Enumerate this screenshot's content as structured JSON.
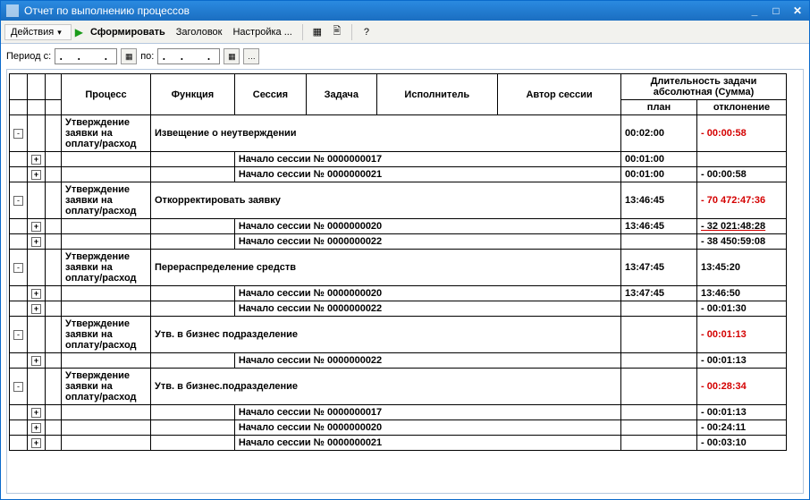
{
  "window": {
    "title": "Отчет по выполнению процессов"
  },
  "toolbar": {
    "actions": "Действия",
    "generate": "Сформировать",
    "header": "Заголовок",
    "settings": "Настройка ..."
  },
  "period": {
    "label_from": "Период с:",
    "label_to": "по:",
    "value_from": ". .  . .   ",
    "value_to": ". .  . .   "
  },
  "columns": {
    "process": "Процесс",
    "function": "Функция",
    "session": "Сессия",
    "task": "Задача",
    "executor": "Исполнитель",
    "author": "Автор сессии",
    "duration_group": "Длительность задачи абсолютная (Сумма)",
    "plan": "план",
    "deviation": "отклонение"
  },
  "rows": [
    {
      "kind": "group",
      "expand": "-",
      "process": "Утверждение заявки на оплату/расход",
      "function": "Извещение о неутверждении",
      "plan": "00:02:00",
      "dev": "- 00:00:58",
      "dev_neg": true,
      "sessions": [
        {
          "kind": "session",
          "band": "teal",
          "expand": "+",
          "label": "Начало сессии № 0000000017",
          "plan": "00:01:00",
          "dev": ""
        },
        {
          "kind": "session",
          "band": "teal",
          "expand": "+",
          "label": "Начало сессии № 0000000021",
          "plan": "00:01:00",
          "dev": "- 00:00:58",
          "dev_neg": true
        }
      ]
    },
    {
      "kind": "group",
      "expand": "-",
      "process": "Утверждение заявки на оплату/расход",
      "function": "Откорректировать заявку",
      "plan": "13:46:45",
      "dev": "- 70 472:47:36",
      "dev_neg": true,
      "sessions": [
        {
          "kind": "session",
          "band": "cyan",
          "expand": "+",
          "label": "Начало сессии № 0000000020",
          "plan": "13:46:45",
          "dev": "- 32 021:48:28",
          "dev_neg": true,
          "dev_underline": true
        },
        {
          "kind": "session",
          "band": "cyan",
          "expand": "+",
          "label": "Начало сессии № 0000000022",
          "plan": "",
          "dev": "- 38 450:59:08",
          "dev_neg": true
        }
      ]
    },
    {
      "kind": "group",
      "expand": "-",
      "process": "Утверждение заявки на оплату/расход",
      "function": "Перераспределение средств",
      "plan": "13:47:45",
      "dev": "13:45:20",
      "sessions": [
        {
          "kind": "session",
          "band": "cyan",
          "expand": "+",
          "label": "Начало сессии № 0000000020",
          "plan": "13:47:45",
          "dev": "13:46:50"
        },
        {
          "kind": "session",
          "band": "cyan",
          "expand": "+",
          "label": "Начало сессии № 0000000022",
          "plan": "",
          "dev": "- 00:01:30",
          "dev_neg": true
        }
      ]
    },
    {
      "kind": "group",
      "expand": "-",
      "process": "Утверждение заявки на оплату/расход",
      "function": "Утв. в бизнес подразделение",
      "plan": "",
      "dev": "- 00:01:13",
      "dev_neg": true,
      "sessions": [
        {
          "kind": "session",
          "band": "cyan",
          "expand": "+",
          "label": "Начало сессии № 0000000022",
          "plan": "",
          "dev": "- 00:01:13",
          "dev_neg": true
        }
      ]
    },
    {
      "kind": "group",
      "expand": "-",
      "process": "Утверждение заявки на оплату/расход",
      "function": "Утв. в бизнес.подразделение",
      "plan": "",
      "dev": "- 00:28:34",
      "dev_neg": true,
      "sessions": [
        {
          "kind": "session",
          "band": "teal",
          "expand": "+",
          "label": "Начало сессии № 0000000017",
          "plan": "",
          "dev": "- 00:01:13",
          "dev_neg": true
        },
        {
          "kind": "session",
          "band": "cyan",
          "expand": "+",
          "label": "Начало сессии № 0000000020",
          "plan": "",
          "dev": "- 00:24:11",
          "dev_neg": true
        },
        {
          "kind": "session",
          "band": "teal",
          "expand": "+",
          "label": "Начало сессии № 0000000021",
          "plan": "",
          "dev": "- 00:03:10",
          "dev_neg": true
        }
      ]
    }
  ]
}
